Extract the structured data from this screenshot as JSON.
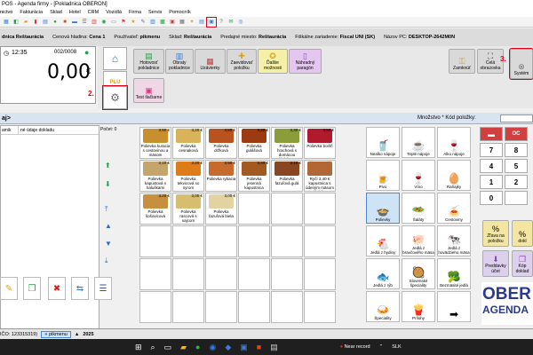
{
  "window": {
    "title": "POS - Agenda firmy - [Pokladnica OBERON]"
  },
  "menu": [
    "nictvo",
    "Fakturácia",
    "Sklad",
    "Hotel",
    "CRM",
    "Vozidlá",
    "Firma",
    "Servis",
    "Pomocník"
  ],
  "info": {
    "name": "dnica Reštaurácia",
    "price_label": "Cenová hladina:",
    "price_value": "Cena 1",
    "user_label": "Používateľ:",
    "user_value": "pikmenu",
    "store_label": "Sklad:",
    "store_value": "Reštaurácia",
    "place_label": "Predajné miesto:",
    "place_value": "Reštaurácia",
    "fiscal_label": "Fiškálne zariadenie:",
    "fiscal_value": "Fiscal UNI (SK)",
    "pc_label": "Názov PC:",
    "pc_value": "DESKTOP-2642M0N"
  },
  "register": {
    "time": "12:35",
    "doc": "002/0008",
    "total": "0,00",
    "currency": "€"
  },
  "top_buttons": {
    "hotovost": "Hotovosť pokladnice",
    "obraty": "Obraty pokladnice",
    "uzavierky": "Uzávierky",
    "zaevidovat": "Zaevidovať položku",
    "dalsie": "Ďalšie možnosti",
    "nahradny": "Náhradný paragón",
    "test": "Test tlačiarne",
    "zamknut": "Zamknúť",
    "cela": "Celá obrazovka",
    "system": "Systém"
  },
  "annotations": {
    "a2": "2.",
    "a3": "3."
  },
  "qty_bar": {
    "left": "aj>",
    "label": "Množstvo * Kód položky:"
  },
  "items_table": {
    "count": "Počet: 0",
    "col1": "amik",
    "col2": "né údaje dokladu"
  },
  "products": [
    {
      "name": "Polievka kuracia s cestovinou a mäsom",
      "price": "3,50 €",
      "color": "#c8902c"
    },
    {
      "name": "Polievka cesnaková",
      "price": "3,20 €",
      "color": "#d9b35a"
    },
    {
      "name": "Polievka držková",
      "price": "3,80 €",
      "color": "#b8521e"
    },
    {
      "name": "Polievka gulášová",
      "price": "3,20 €",
      "color": "#9c3a12"
    },
    {
      "name": "Polievka hrachová s domácou klobásou",
      "price": "3,30 €",
      "color": "#8b9c3a"
    },
    {
      "name": "Polievka boršč",
      "price": "3,60 €",
      "color": "#b11a2c"
    },
    {
      "name": "Polievka kapustová s haluškami",
      "price": "3,10 €",
      "color": "#c6a56a"
    },
    {
      "name": "Polievka tekvicová so syrom",
      "price": "3,20 €",
      "color": "#e07b1a"
    },
    {
      "name": "Polievka rybacia",
      "price": "3,50 €",
      "color": "#c76a2e"
    },
    {
      "name": "Polievka jesenná kapustnica",
      "price": "3,40 €",
      "color": "#a25a20"
    },
    {
      "name": "Polievka fazuľová gulá",
      "price": "3,10 €",
      "color": "#8a4620"
    },
    {
      "name": "Ryčí 3,40 € kapustnica s údeným mäsom a klobásou",
      "price": "",
      "color": "#b36636"
    },
    {
      "name": "Polievka šošovicová",
      "price": "3,20 €",
      "color": "#c7903e"
    },
    {
      "name": "Polievka rascová s vajcom",
      "price": "3,00 €",
      "color": "#d7bd70"
    },
    {
      "name": "Polievka fazuľová biela",
      "price": "3,00 €",
      "color": "#e3d3a3"
    }
  ],
  "categories": [
    {
      "name": "Nealko nápoje",
      "icon": "🥤"
    },
    {
      "name": "Teplé nápoje",
      "icon": "☕"
    },
    {
      "name": "Alko nápoje",
      "icon": "🍷"
    },
    {
      "name": "Pivo",
      "icon": "🍺"
    },
    {
      "name": "Víno",
      "icon": "🍷"
    },
    {
      "name": "Raňajky",
      "icon": "🥚"
    },
    {
      "name": "Polievky",
      "icon": "🍲"
    },
    {
      "name": "Šaláty",
      "icon": "🥗"
    },
    {
      "name": "Cestoviny",
      "icon": "🍝"
    },
    {
      "name": "Jedlá z hydiny",
      "icon": "🐔"
    },
    {
      "name": "Jedlá z bravčového mäsa",
      "icon": "🐖"
    },
    {
      "name": "Jedlá z hovädzieho mäsa",
      "icon": "🐄"
    },
    {
      "name": "Jedlá z rýb",
      "icon": "🐟"
    },
    {
      "name": "Slovenské špeciality",
      "icon": "🥘"
    },
    {
      "name": "Bezmäsité jedlá",
      "icon": "🥦"
    },
    {
      "name": "Špeciality",
      "icon": "🍛"
    },
    {
      "name": "Prílohy",
      "icon": "🍟"
    },
    {
      "name": "",
      "icon": "➡"
    }
  ],
  "numpad": [
    "",
    "OC",
    "7",
    "8",
    "4",
    "5",
    "1",
    "2",
    "0",
    ""
  ],
  "right_actions": {
    "zleva": "Zľava na položku",
    "dokl": "dokl",
    "prad": "Preddavky účet",
    "kop": "Kóp doklad"
  },
  "brand": {
    "line1": "OBER",
    "line2": "AGENDA"
  },
  "status": {
    "ico": "IČO: 123315319)",
    "user": "pikmenu",
    "year": "2025"
  },
  "taskbar": {
    "record": "Near record",
    "lang": "SLK"
  }
}
